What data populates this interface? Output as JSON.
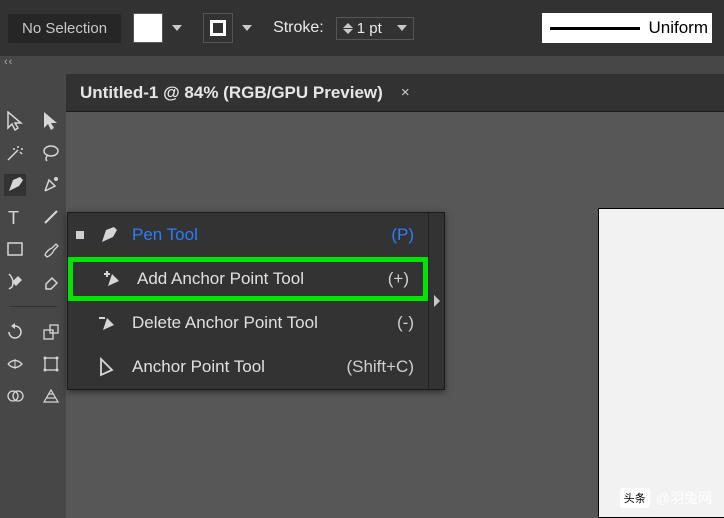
{
  "options": {
    "no_selection": "No Selection",
    "stroke_label": "Stroke:",
    "stroke_value": "1 pt",
    "profile_label": "Uniform",
    "fill_color": "#ffffff",
    "stroke_color": "#ffffff"
  },
  "collapse_glyph": "‹‹",
  "tab": {
    "title": "Untitled-1 @ 84% (RGB/GPU Preview)",
    "close": "×"
  },
  "flyout": {
    "items": [
      {
        "icon": "pen",
        "label": "Pen Tool",
        "shortcut": "(P)",
        "selected": true,
        "highlighted": false,
        "kind": "pen"
      },
      {
        "icon": "pen-plus",
        "label": "Add Anchor Point Tool",
        "shortcut": "(+)",
        "selected": false,
        "highlighted": true,
        "kind": "add"
      },
      {
        "icon": "pen-minus",
        "label": "Delete Anchor Point Tool",
        "shortcut": "(-)",
        "selected": false,
        "highlighted": false,
        "kind": "del"
      },
      {
        "icon": "anchor",
        "label": "Anchor Point Tool",
        "shortcut": "(Shift+C)",
        "selected": false,
        "highlighted": false,
        "kind": "anchor"
      }
    ]
  },
  "watermark": {
    "badge": "头条",
    "text": "@羽兔网"
  }
}
